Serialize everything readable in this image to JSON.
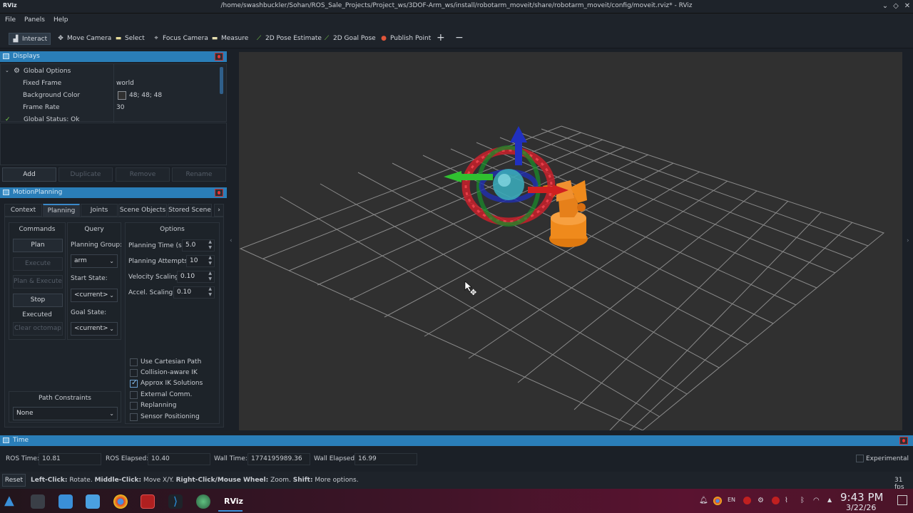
{
  "window": {
    "app_logo": "RViz",
    "title": "/home/swashbuckler/Sohan/ROS_Sale_Projects/Project_ws/3DOF-Arm_ws/install/robotarm_moveit/share/robotarm_moveit/config/moveit.rviz* - RViz"
  },
  "menu": {
    "file": "File",
    "panels": "Panels",
    "help": "Help"
  },
  "toolbar": {
    "interact": "Interact",
    "move_camera": "Move Camera",
    "select": "Select",
    "focus_camera": "Focus Camera",
    "measure": "Measure",
    "pose_estimate": "2D Pose Estimate",
    "goal_pose": "2D Goal Pose",
    "publish_point": "Publish Point",
    "add_symbol": "+",
    "remove_symbol": "−"
  },
  "displays": {
    "title": "Displays",
    "global_options": "Global Options",
    "rows": [
      {
        "name": "Fixed Frame",
        "value": "world"
      },
      {
        "name": "Background Color",
        "value": "48; 48; 48"
      },
      {
        "name": "Frame Rate",
        "value": "30"
      }
    ],
    "partial_row": "Global Status: Ok",
    "background_color_swatch": "#303030",
    "buttons": {
      "add": "Add",
      "duplicate": "Duplicate",
      "remove": "Remove",
      "rename": "Rename"
    }
  },
  "motion_planning": {
    "title": "MotionPlanning",
    "tabs": [
      "Context",
      "Planning",
      "Joints",
      "Scene Objects",
      "Stored Scene"
    ],
    "selected_tab": "Planning",
    "commands": {
      "title": "Commands",
      "plan": "Plan",
      "execute": "Execute",
      "plan_execute": "Plan & Execute",
      "stop": "Stop",
      "status": "Executed",
      "clear_octomap": "Clear octomap"
    },
    "query": {
      "title": "Query",
      "planning_group_label": "Planning Group:",
      "planning_group": "arm",
      "start_state_label": "Start State:",
      "start_state": "<current>",
      "goal_state_label": "Goal State:",
      "goal_state": "<current>"
    },
    "options": {
      "title": "Options",
      "planning_time_label": "Planning Time (s):",
      "planning_time": "5.0",
      "planning_attempts_label": "Planning Attempts:",
      "planning_attempts": "10",
      "velocity_scaling_label": "Velocity Scaling:",
      "velocity_scaling": "0.10",
      "accel_scaling_label": "Accel. Scaling:",
      "accel_scaling": "0.10",
      "checkboxes": [
        {
          "label": "Use Cartesian Path",
          "checked": false
        },
        {
          "label": "Collision-aware IK",
          "checked": false
        },
        {
          "label": "Approx IK Solutions",
          "checked": true
        },
        {
          "label": "External Comm.",
          "checked": false
        },
        {
          "label": "Replanning",
          "checked": false
        },
        {
          "label": "Sensor Positioning",
          "checked": false
        }
      ]
    },
    "path_constraints": {
      "title": "Path Constraints",
      "value": "None"
    }
  },
  "time_panel": {
    "title": "Time",
    "ros_time_label": "ROS Time:",
    "ros_time": "10.81",
    "ros_elapsed_label": "ROS Elapsed:",
    "ros_elapsed": "10.40",
    "wall_time_label": "Wall Time:",
    "wall_time": "1774195989.36",
    "wall_elapsed_label": "Wall Elapsed:",
    "wall_elapsed": "16.99",
    "experimental": "Experimental"
  },
  "statusbar": {
    "reset": "Reset",
    "left_click_bold": "Left-Click:",
    "left_click": " Rotate. ",
    "middle_click_bold": "Middle-Click:",
    "middle_click": " Move X/Y. ",
    "right_click_bold": "Right-Click/Mouse Wheel:",
    "right_click": " Zoom. ",
    "shift_bold": "Shift:",
    "shift": " More options.",
    "fps": "31 fps"
  },
  "taskbar": {
    "rviz_label": "RViz",
    "lang": "EN",
    "time": "9:43 PM",
    "date": "3/22/26"
  },
  "colors": {
    "accent": "#2a7eb8",
    "viewport_bg": "#303030",
    "grid": "#a0a0a0",
    "robot": "#ef8a1c"
  }
}
